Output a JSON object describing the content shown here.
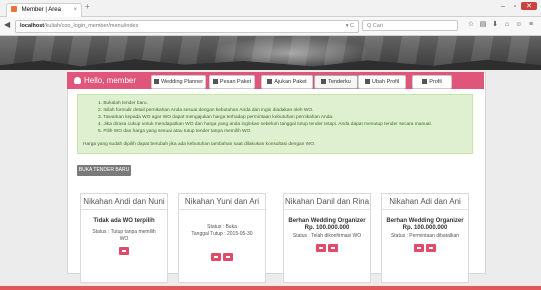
{
  "browser": {
    "tab_title": "Member | Area",
    "tab_close": "×",
    "new_tab": "+",
    "window_controls": [
      "–",
      "▫",
      "✕"
    ],
    "back": "◀",
    "url_host": "localhost",
    "url_path": "/kuliah/coo_login_member/menu/index",
    "reload": "▾ C",
    "search_placeholder": "Q Cari",
    "toolbar_icons": [
      "☆",
      "▤",
      "⬇",
      "⌂",
      "☺",
      "≡"
    ]
  },
  "header": {
    "hello": "Hello, member",
    "tabs": [
      {
        "label": "Wedding Planner"
      },
      {
        "label": "Pesan Paket"
      },
      {
        "label": "Ajukan Paket"
      },
      {
        "label": "Tenderku"
      },
      {
        "label": "Ubah Profil"
      },
      {
        "label": "Profil"
      }
    ]
  },
  "info": {
    "steps": [
      "1. Bukalah tender baru.",
      "2. Isilah formulir detail pernikahan Anda sesuai dengan kebutuhan Anda dan ingin diadakan oleh WO.",
      "3. Tawarkan kepada WO agar WO dapat mengajukan harga terhadap permintaan kebutuhan pernikahan Anda.",
      "4. Jika dirasa cukup untuk mendapatkan WO dan harga yang anda inginkan sebelum tanggal tutup tender tetapi. Anda dapat menutup tender secara manual.",
      "5. Pilih WO dan harga yang sesuai atau tutup tender tanpa memilih WO."
    ],
    "note": "Harga yang sudah dipilih dapat berubah jika ada kebutuhan tambahan saat dilakukan konsultasi dengan WO."
  },
  "buka_button": "BUKA TENDER BARU",
  "packages": [
    {
      "title": "Nikahan Andi dan Nuni",
      "line1": "Tidak ada WO terpilih",
      "line2": "Status : Tutup tanpa memilih",
      "line3": "WO"
    },
    {
      "title": "Nikahan Yuni dan Ari",
      "line1": "Status : Buka",
      "line2": "Tanggal Tutup : 2015-05-30",
      "line3": ""
    },
    {
      "title": "Nikahan Danil dan Rina",
      "line1": "Berhan Wedding Organizer",
      "line2": "Rp. 100.000.000",
      "line3": "Status : Telah dikonfirmasi WO"
    },
    {
      "title": "Nikahan Adi dan Ani",
      "line1": "Berhan Wedding Organizer",
      "line2": "Rp. 100.000.000",
      "line3": "Status : Permintaan dibatalkan"
    }
  ],
  "colors": {
    "accent": "#e0557a",
    "info_bg": "#dff0d0",
    "button_red": "#e04a6b"
  }
}
